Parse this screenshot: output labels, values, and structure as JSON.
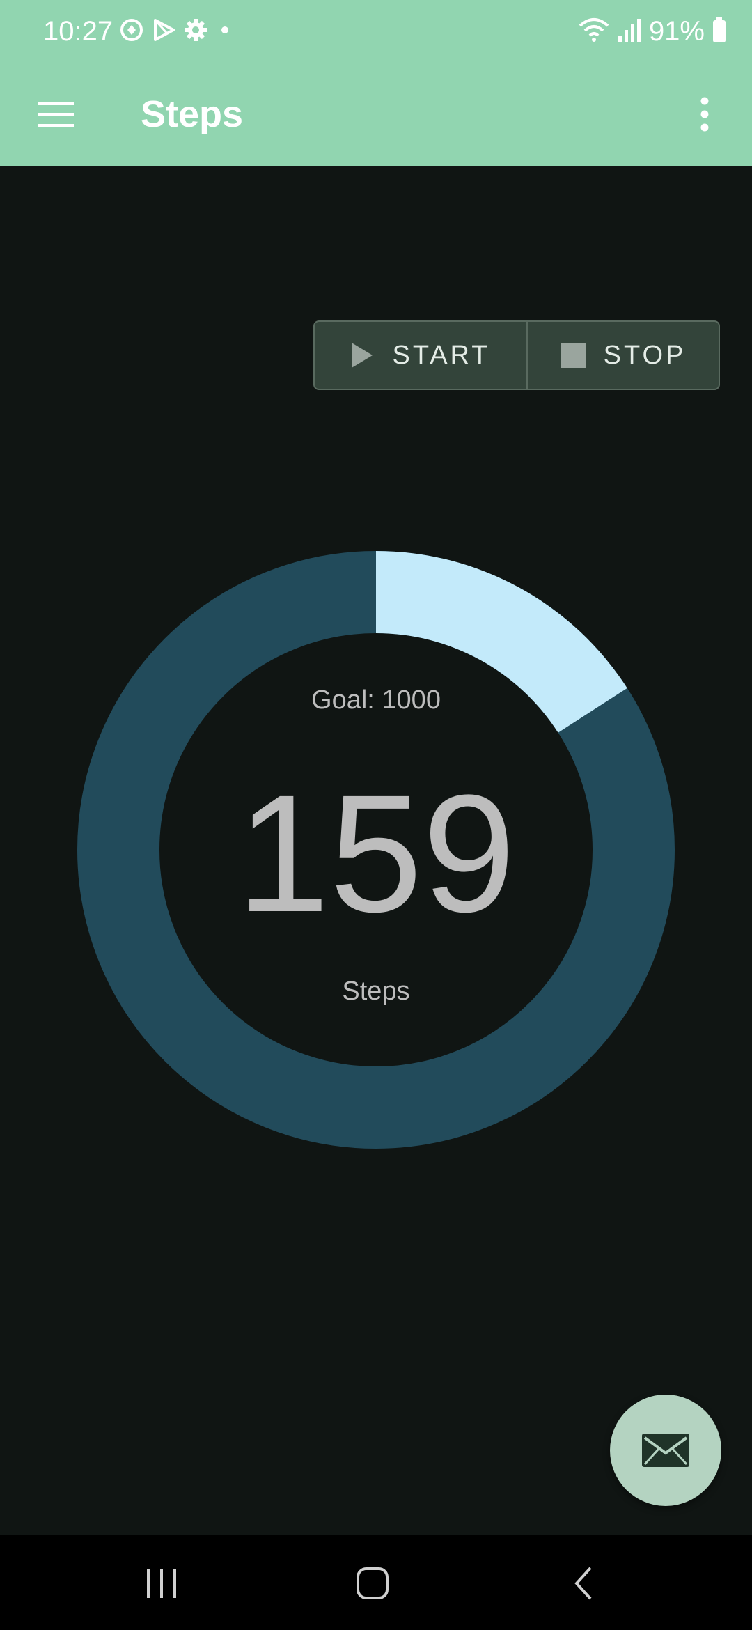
{
  "status_bar": {
    "time": "10:27",
    "battery_percent": "91%",
    "icons": [
      "sync-icon",
      "play-store-icon",
      "settings-icon",
      "dot-icon",
      "wifi-icon",
      "signal-icon",
      "battery-icon"
    ]
  },
  "app_bar": {
    "title": "Steps",
    "background": "#91d5b0"
  },
  "controls": {
    "start_label": "START",
    "stop_label": "STOP"
  },
  "progress": {
    "goal_text": "Goal: 1000",
    "count": "159",
    "unit": "Steps",
    "fraction": 0.159,
    "ring_color": "#224b5b",
    "fill_color": "#c3eafa"
  },
  "fab": {
    "icon": "mail-icon",
    "color": "#b4d3c1"
  },
  "nav_bar": {
    "icons": [
      "recent-apps-icon",
      "home-icon",
      "back-icon"
    ]
  }
}
